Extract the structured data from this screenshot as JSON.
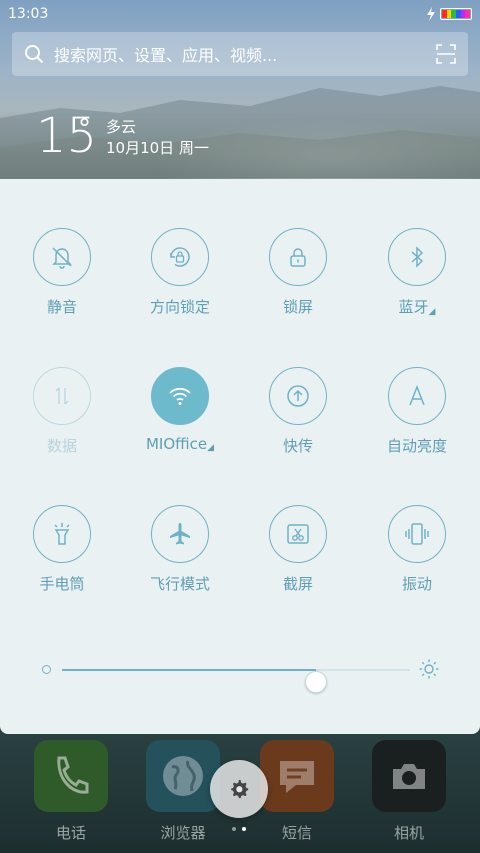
{
  "status_bar": {
    "time": "13:03"
  },
  "search": {
    "placeholder": "搜索网页、设置、应用、视频..."
  },
  "weather": {
    "temperature": "15",
    "degree": "°",
    "condition": "多云",
    "date": "10月10日 周一"
  },
  "quick_settings": {
    "toggles": [
      {
        "label": "静音",
        "icon": "bell-mute-icon",
        "state": "off"
      },
      {
        "label": "方向锁定",
        "icon": "rotation-lock-icon",
        "state": "off"
      },
      {
        "label": "锁屏",
        "icon": "lock-icon",
        "state": "off"
      },
      {
        "label": "蓝牙",
        "icon": "bluetooth-icon",
        "state": "off",
        "has_menu": true
      },
      {
        "label": "数据",
        "icon": "mobile-data-icon",
        "state": "disabled"
      },
      {
        "label": "MIOffice",
        "icon": "wifi-icon",
        "state": "on",
        "has_menu": true
      },
      {
        "label": "快传",
        "icon": "quick-transfer-icon",
        "state": "off"
      },
      {
        "label": "自动亮度",
        "icon": "auto-brightness-icon",
        "state": "off"
      },
      {
        "label": "手电筒",
        "icon": "flashlight-icon",
        "state": "off"
      },
      {
        "label": "飞行模式",
        "icon": "airplane-icon",
        "state": "off"
      },
      {
        "label": "截屏",
        "icon": "screenshot-icon",
        "state": "off"
      },
      {
        "label": "振动",
        "icon": "vibrate-icon",
        "state": "off"
      }
    ],
    "brightness_level": 0.73
  },
  "dock": {
    "apps": [
      {
        "label": "电话",
        "icon": "phone-icon",
        "color": "#2f6b2a"
      },
      {
        "label": "浏览器",
        "icon": "globe-icon",
        "color": "#2b5f70"
      },
      {
        "label": "短信",
        "icon": "message-icon",
        "color": "#8a4a1e"
      },
      {
        "label": "相机",
        "icon": "camera-icon",
        "color": "#1c2021"
      }
    ]
  },
  "colors": {
    "accent": "#6cbacb",
    "panel_bg": "#eaf1f3",
    "label": "#5f9fb4"
  }
}
